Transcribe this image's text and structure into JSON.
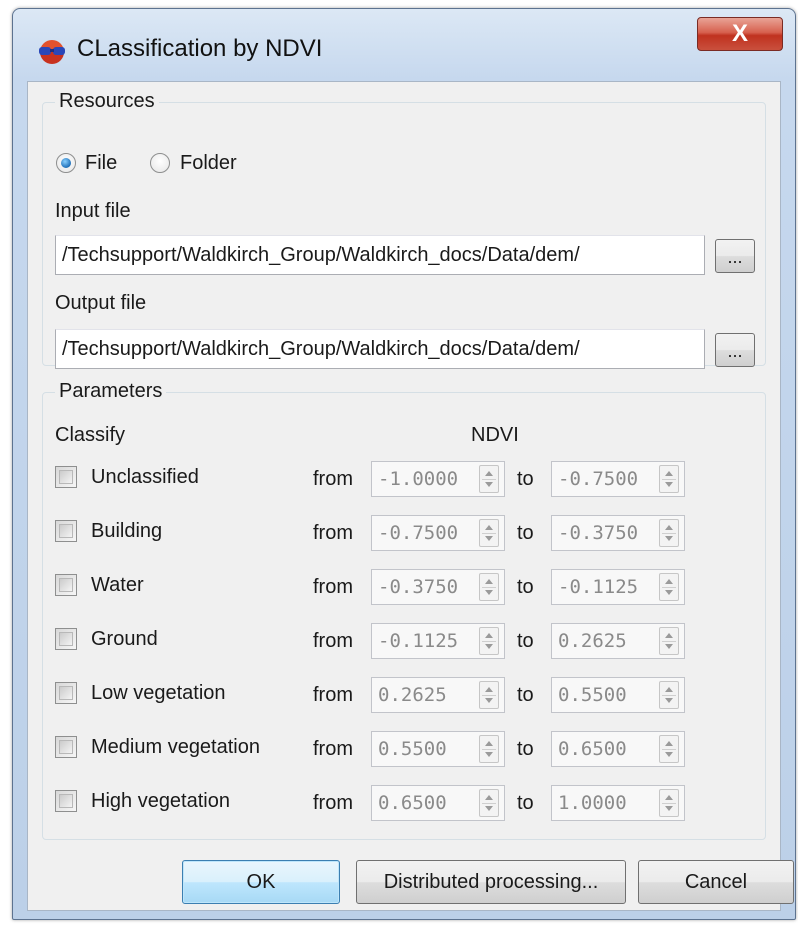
{
  "window": {
    "title": "CLassification by NDVI",
    "close_label": "X"
  },
  "resources": {
    "group_title": "Resources",
    "radio_file_label": "File",
    "radio_folder_label": "Folder",
    "selected": "File",
    "input_label": "Input file",
    "input_value": "/Techsupport/Waldkirch_Group/Waldkirch_docs/Data/dem/",
    "output_label": "Output file",
    "output_value": "/Techsupport/Waldkirch_Group/Waldkirch_docs/Data/dem/",
    "browse_label": "..."
  },
  "parameters": {
    "group_title": "Parameters",
    "classify_header": "Classify",
    "ndvi_header": "NDVI",
    "from_label": "from",
    "to_label": "to",
    "rows": [
      {
        "label": "Unclassified",
        "checked": false,
        "from": "-1.0000",
        "to": "-0.7500"
      },
      {
        "label": "Building",
        "checked": false,
        "from": "-0.7500",
        "to": "-0.3750"
      },
      {
        "label": "Water",
        "checked": false,
        "from": "-0.3750",
        "to": "-0.1125"
      },
      {
        "label": "Ground",
        "checked": false,
        "from": "-0.1125",
        "to": "0.2625"
      },
      {
        "label": "Low vegetation",
        "checked": false,
        "from": "0.2625",
        "to": "0.5500"
      },
      {
        "label": "Medium vegetation",
        "checked": false,
        "from": "0.5500",
        "to": "0.6500"
      },
      {
        "label": "High vegetation",
        "checked": false,
        "from": "0.6500",
        "to": "1.0000"
      }
    ]
  },
  "buttons": {
    "ok": "OK",
    "distributed": "Distributed processing...",
    "cancel": "Cancel"
  }
}
